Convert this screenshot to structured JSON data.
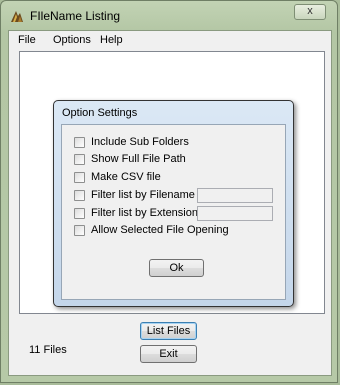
{
  "window": {
    "title": "FIleName Listing",
    "close_glyph": "x"
  },
  "menu": {
    "items": [
      {
        "label": "File"
      },
      {
        "label": "Options"
      },
      {
        "label": "Help"
      }
    ]
  },
  "dialog": {
    "title": "Option Settings",
    "options": [
      {
        "label": "Include Sub Folders",
        "checked": false
      },
      {
        "label": "Show Full File Path",
        "checked": false
      },
      {
        "label": "Make CSV file",
        "checked": false
      },
      {
        "label": "Filter list by Filename",
        "checked": false,
        "input_value": ""
      },
      {
        "label": "Filter list by Extension",
        "checked": false,
        "input_value": ""
      },
      {
        "label": "Allow Selected File Opening",
        "checked": false
      }
    ],
    "ok_label": "Ok"
  },
  "footer": {
    "count_text": "11  Files",
    "list_files_label": "List Files",
    "exit_label": "Exit"
  },
  "colors": {
    "frame": "#b3c6a4",
    "dialog_frame": "#c4d6ea",
    "client": "#f0f0f0"
  }
}
